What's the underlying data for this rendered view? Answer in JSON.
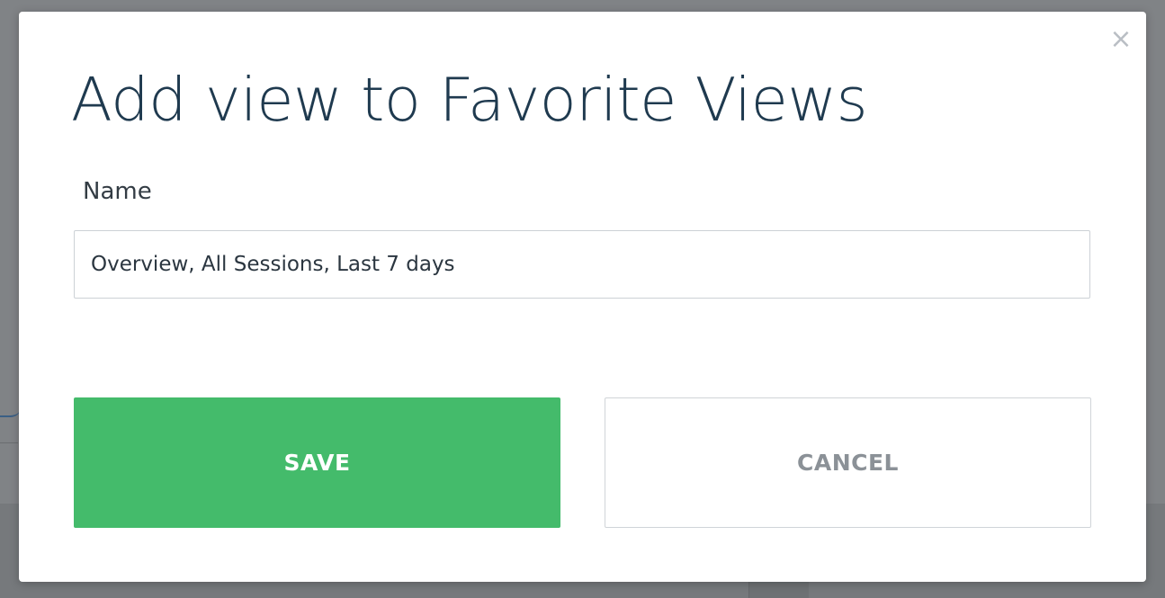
{
  "dialog": {
    "title": "Add view to Favorite Views",
    "close_glyph": "×",
    "close_icon": "close-icon",
    "name_label": "Name",
    "name_value": "Overview, All Sessions, Last 7 days",
    "save_label": "SAVE",
    "cancel_label": "CANCEL"
  },
  "colors": {
    "title": "#1f3a4f",
    "save_button": "#44bb6b",
    "cancel_text": "#8b9197",
    "overlay": "#808386"
  }
}
